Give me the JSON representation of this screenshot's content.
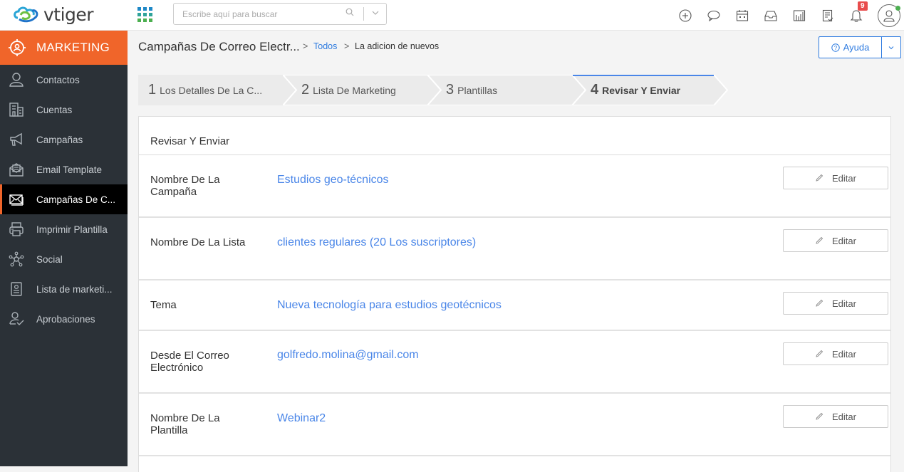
{
  "app": {
    "logo_text": "vtiger",
    "search_placeholder": "Escribe aquí para buscar",
    "notification_count": "9"
  },
  "colors": {
    "accent_orange": "#f0652a",
    "link_blue": "#4a86e8",
    "primary_blue": "#2e7be0",
    "sidebar_bg": "#2b3137"
  },
  "top_icons": [
    "plus-circle-icon",
    "chat-icon",
    "calendar-icon",
    "inbox-icon",
    "reports-icon",
    "tasks-icon",
    "bell-icon",
    "user-avatar-icon"
  ],
  "sidebar": {
    "module_label": "MARKETING",
    "items": [
      {
        "label": "Contactos",
        "icon": "user-icon",
        "active": false
      },
      {
        "label": "Cuentas",
        "icon": "building-icon",
        "active": false
      },
      {
        "label": "Campañas",
        "icon": "megaphone-icon",
        "active": false
      },
      {
        "label": "Email Template",
        "icon": "email-template-icon",
        "active": false
      },
      {
        "label": "Campañas De C...",
        "icon": "envelope-icon",
        "active": true
      },
      {
        "label": "Imprimir Plantilla",
        "icon": "printer-icon",
        "active": false
      },
      {
        "label": "Social",
        "icon": "network-icon",
        "active": false
      },
      {
        "label": "Lista de marketi...",
        "icon": "contact-card-icon",
        "active": false
      },
      {
        "label": "Aprobaciones",
        "icon": "user-check-icon",
        "active": false
      }
    ]
  },
  "header": {
    "title": "Campañas De Correo Electr...",
    "breadcrumb": [
      {
        "label": "Todos",
        "link": true
      },
      {
        "label": "La adicion de nuevos",
        "link": false
      }
    ],
    "help_label": "Ayuda"
  },
  "steps": [
    {
      "number": "1",
      "label": "Los Detalles De La C...",
      "current": false
    },
    {
      "number": "2",
      "label": "Lista De Marketing",
      "current": false
    },
    {
      "number": "3",
      "label": "Plantillas",
      "current": false
    },
    {
      "number": "4",
      "label": "Revisar Y Enviar",
      "current": true
    }
  ],
  "review": {
    "title": "Revisar Y Enviar",
    "edit_label": "Editar",
    "rows": [
      {
        "label": "Nombre De La Campaña",
        "value": "Estudios geo-técnicos"
      },
      {
        "label": "Nombre De La Lista",
        "value": "clientes regulares (20 Los suscriptores)"
      },
      {
        "label": "Tema",
        "value": "Nueva tecnología para estudios geotécnicos"
      },
      {
        "label": "Desde El Correo Electrónico",
        "value": "golfredo.molina@gmail.com"
      },
      {
        "label": "Nombre De La Plantilla",
        "value": "Webinar2"
      }
    ]
  }
}
